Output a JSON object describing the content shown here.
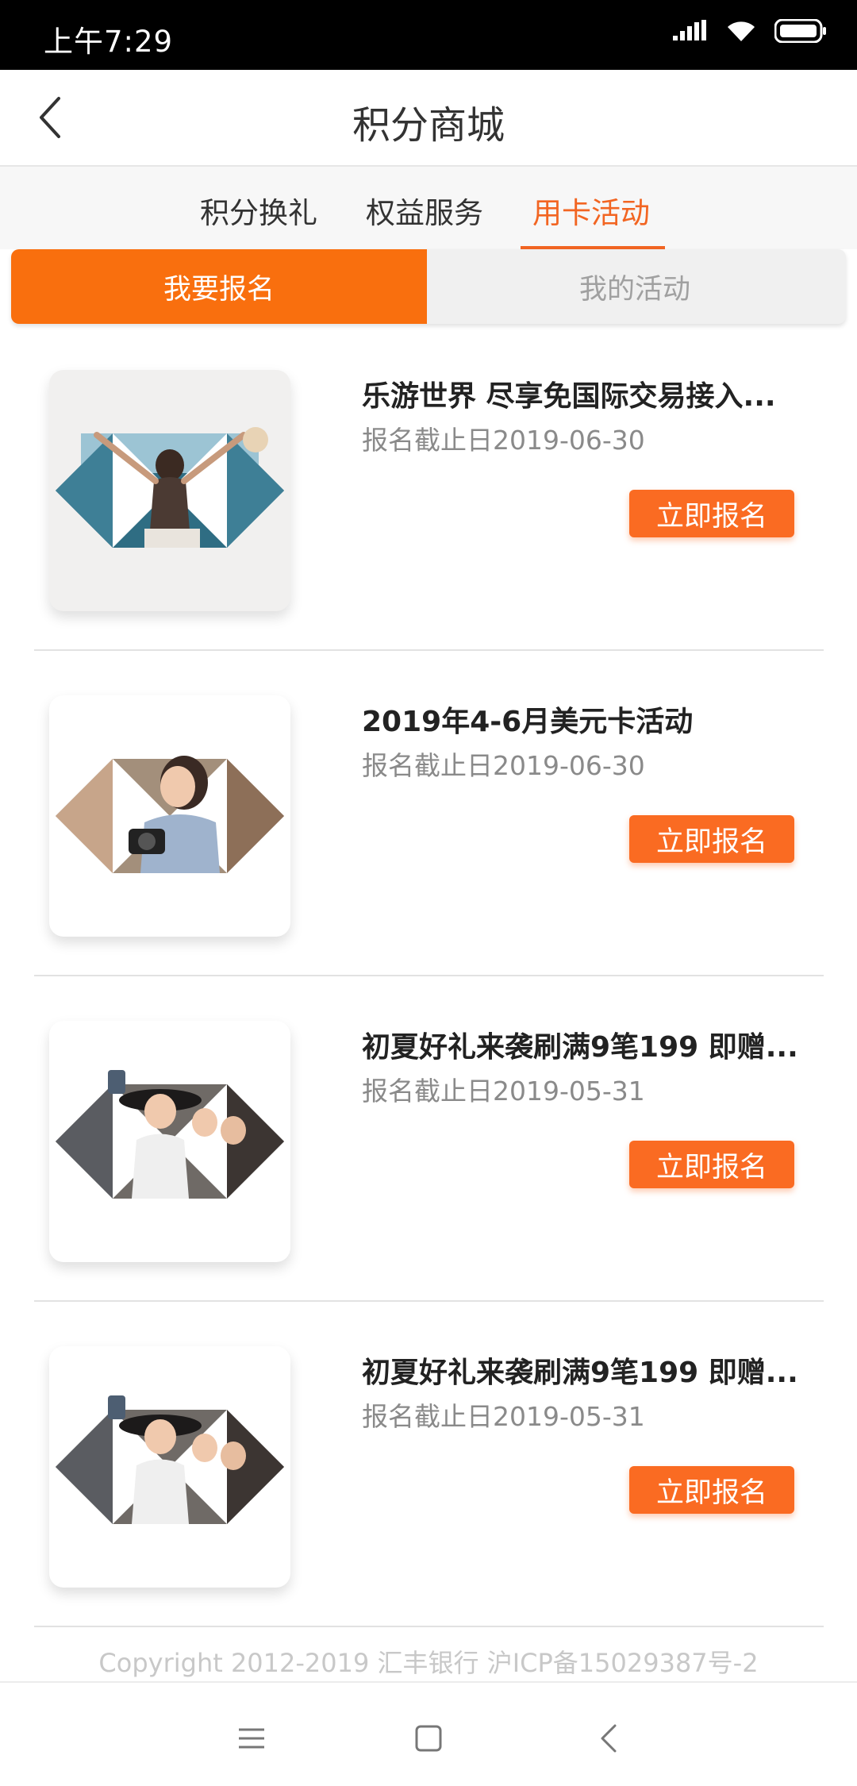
{
  "status": {
    "time": "上午7:29"
  },
  "header": {
    "title": "积分商城"
  },
  "tabs": [
    {
      "label": "积分换礼",
      "active": false
    },
    {
      "label": "权益服务",
      "active": false
    },
    {
      "label": "用卡活动",
      "active": true
    }
  ],
  "segment": {
    "signup": "我要报名",
    "mine": "我的活动"
  },
  "activities": [
    {
      "title": "乐游世界 尽享免国际交易接入...",
      "date": "报名截止日2019-06-30",
      "button": "立即报名"
    },
    {
      "title": "2019年4-6月美元卡活动",
      "date": "报名截止日2019-06-30",
      "button": "立即报名"
    },
    {
      "title": "初夏好礼来袭刷满9笔199 即赠...",
      "date": "报名截止日2019-05-31",
      "button": "立即报名"
    },
    {
      "title": "初夏好礼来袭刷满9笔199 即赠...",
      "date": "报名截止日2019-05-31",
      "button": "立即报名"
    }
  ],
  "footer": {
    "copyright": "Copyright 2012-2019 汇丰银行 沪ICP备15029387号-2"
  },
  "colors": {
    "accent": "#f26522",
    "button": "#fa6b22"
  }
}
